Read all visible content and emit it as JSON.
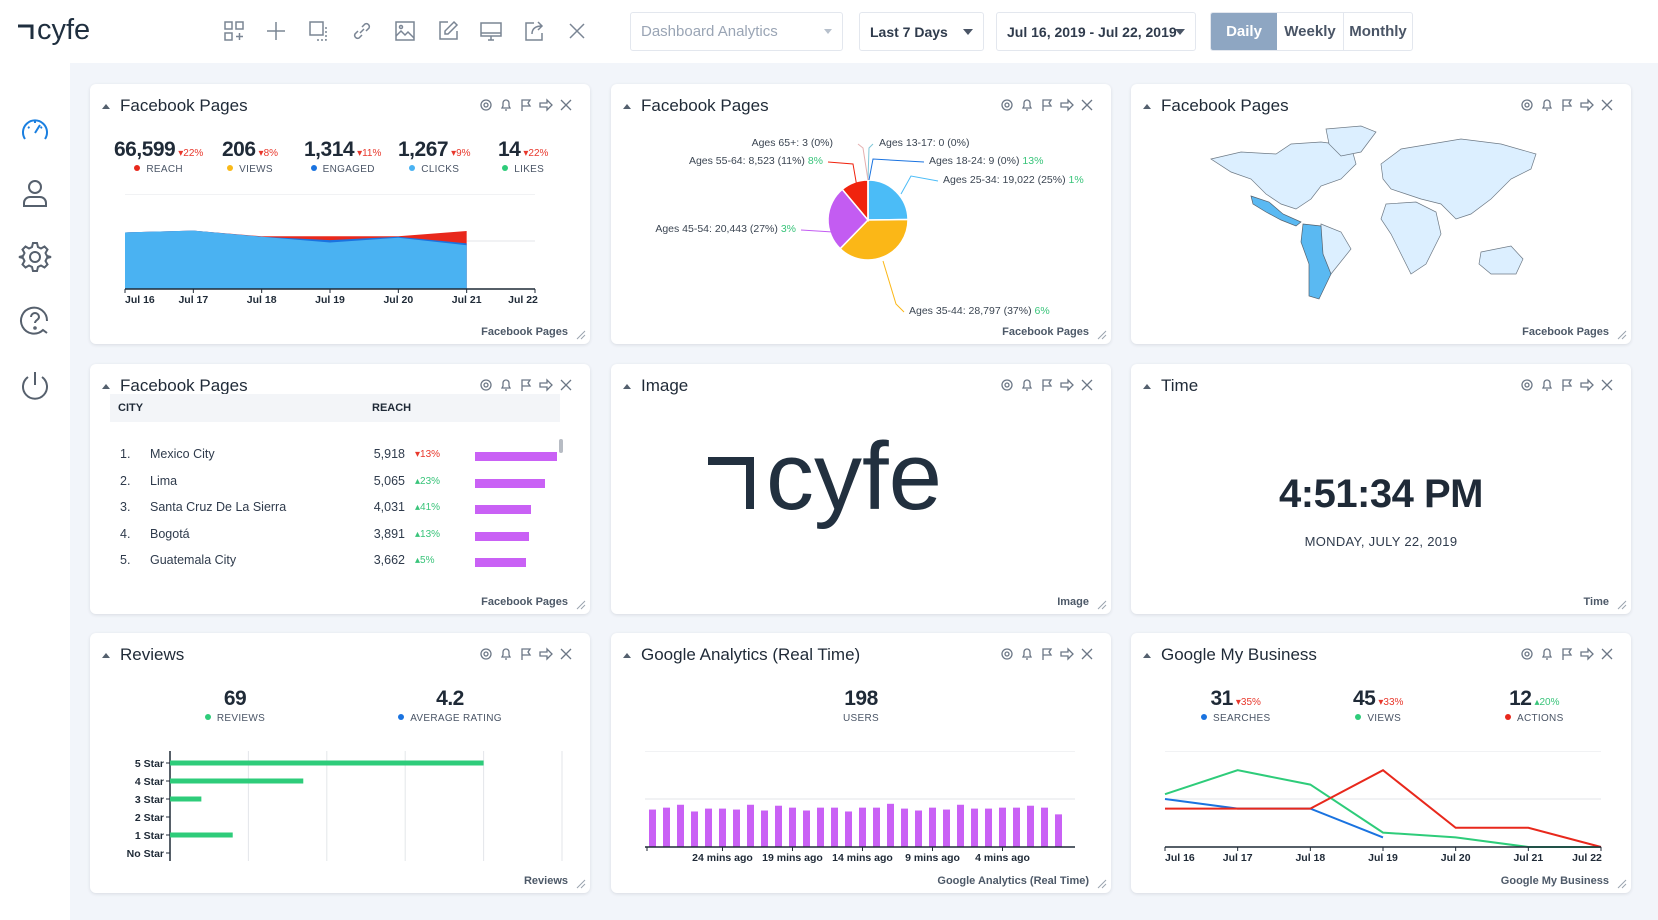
{
  "app": {
    "logo": "cyfe"
  },
  "toolbar": {
    "icons": [
      "add-widget-icon",
      "plus-icon",
      "duplicate-icon",
      "link-icon",
      "image-icon",
      "edit-icon",
      "monitor-icon",
      "share-icon",
      "close-icon"
    ],
    "dashboard_select": {
      "placeholder": "Dashboard Analytics"
    },
    "range_select": {
      "value": "Last 7 Days"
    },
    "date_select": {
      "value": "Jul 16, 2019 - Jul 22, 2019"
    },
    "periods": [
      {
        "label": "Daily",
        "active": true
      },
      {
        "label": "Weekly",
        "active": false
      },
      {
        "label": "Monthly",
        "active": false
      }
    ]
  },
  "sidebar": {
    "items": [
      {
        "icon": "dashboard-gauge-icon",
        "active": true,
        "color": "#1a7fe0"
      },
      {
        "icon": "user-icon",
        "active": false
      },
      {
        "icon": "gear-icon",
        "active": false
      },
      {
        "icon": "help-icon",
        "active": false
      },
      {
        "icon": "power-icon",
        "active": false
      }
    ]
  },
  "colors": {
    "reach": "#e8281c",
    "views": "#f9b918",
    "engaged": "#1a73e0",
    "clicks": "#4ab2f2",
    "likes": "#2ecc7a",
    "down": "#e8382c",
    "up": "#39c47a",
    "bar_purple": "#c961f5",
    "review_green": "#2ecc7a"
  },
  "widgets": {
    "fb_overview": {
      "title": "Facebook Pages",
      "footer": "Facebook Pages",
      "kpis": [
        {
          "value": "66,599",
          "change": "22%",
          "dir": "down",
          "label": "REACH"
        },
        {
          "value": "206",
          "change": "8%",
          "dir": "down",
          "label": "VIEWS"
        },
        {
          "value": "1,314",
          "change": "11%",
          "dir": "down",
          "label": "ENGAGED"
        },
        {
          "value": "1,267",
          "change": "9%",
          "dir": "down",
          "label": "CLICKS"
        },
        {
          "value": "14",
          "change": "22%",
          "dir": "down",
          "label": "LIKES"
        }
      ]
    },
    "fb_demographics": {
      "title": "Facebook Pages",
      "footer": "Facebook Pages"
    },
    "fb_map": {
      "title": "Facebook Pages",
      "footer": "Facebook Pages",
      "highlighted_regions": [
        "Mexico",
        "Central America",
        "Colombia",
        "Ecuador",
        "Peru",
        "Bolivia",
        "Chile",
        "Argentina",
        "Paraguay"
      ]
    },
    "fb_cities": {
      "title": "Facebook Pages",
      "footer": "Facebook Pages",
      "columns": [
        "CITY",
        "REACH"
      ],
      "rows": [
        {
          "rank": "1.",
          "city": "Mexico City",
          "reach": "5,918",
          "reach_value": 5918,
          "change": "13%",
          "dir": "down"
        },
        {
          "rank": "2.",
          "city": "Lima",
          "reach": "5,065",
          "reach_value": 5065,
          "change": "23%",
          "dir": "up"
        },
        {
          "rank": "3.",
          "city": "Santa Cruz De La Sierra",
          "reach": "4,031",
          "reach_value": 4031,
          "change": "41%",
          "dir": "up"
        },
        {
          "rank": "4.",
          "city": "Bogotá",
          "reach": "3,891",
          "reach_value": 3891,
          "change": "13%",
          "dir": "up"
        },
        {
          "rank": "5.",
          "city": "Guatemala City",
          "reach": "3,662",
          "reach_value": 3662,
          "change": "5%",
          "dir": "up"
        }
      ]
    },
    "image": {
      "title": "Image",
      "footer": "Image",
      "logo_text": "cyfe"
    },
    "time": {
      "title": "Time",
      "footer": "Time",
      "time": "4:51:34 PM",
      "date": "MONDAY, JULY 22, 2019"
    },
    "reviews": {
      "title": "Reviews",
      "footer": "Reviews",
      "kpis": [
        {
          "value": "69",
          "label": "REVIEWS",
          "color": "#2ecc7a"
        },
        {
          "value": "4.2",
          "label": "AVERAGE RATING",
          "color": "#1a73e0"
        }
      ]
    },
    "ga": {
      "title": "Google Analytics (Real Time)",
      "footer": "Google Analytics (Real Time)",
      "kpi": {
        "value": "198",
        "label": "USERS"
      }
    },
    "gmb": {
      "title": "Google My Business",
      "footer": "Google My Business",
      "kpis": [
        {
          "value": "31",
          "change": "35%",
          "dir": "down",
          "label": "SEARCHES",
          "color": "#1a73e0"
        },
        {
          "value": "45",
          "change": "33%",
          "dir": "down",
          "label": "VIEWS",
          "color": "#2ecc7a"
        },
        {
          "value": "12",
          "change": "20%",
          "dir": "up",
          "label": "ACTIONS",
          "color": "#e8281c"
        }
      ]
    }
  },
  "chart_data": [
    {
      "id": "fb_area",
      "type": "area",
      "categories": [
        "Jul 16",
        "Jul 17",
        "Jul 18",
        "Jul 19",
        "Jul 20",
        "Jul 21",
        "Jul 22"
      ],
      "ylim": [
        0,
        20000
      ],
      "grid": true,
      "series": [
        {
          "name": "Reach",
          "color": "#e8281c",
          "values": [
            11900,
            12300,
            11100,
            11100,
            11100,
            12200,
            null
          ]
        },
        {
          "name": "Engaged",
          "color": "#1a73e0",
          "values": [
            11900,
            12300,
            11000,
            10300,
            11000,
            9600,
            null
          ]
        },
        {
          "name": "Clicks",
          "color": "#4ab2f2",
          "values": [
            11900,
            12300,
            11000,
            9800,
            10800,
            9200,
            null
          ]
        },
        {
          "name": "Likes",
          "color": "#2ecc7a",
          "values": [
            100,
            100,
            100,
            100,
            100,
            100,
            null
          ]
        }
      ]
    },
    {
      "id": "fb_age_pie",
      "type": "pie",
      "slices": [
        {
          "label": "Ages 13-17",
          "value": 0,
          "pct": "0%",
          "change": "",
          "color": "#7fc6d8"
        },
        {
          "label": "Ages 18-24",
          "value": 9,
          "pct": "0%",
          "change": "13%",
          "color": "#1a73e0"
        },
        {
          "label": "Ages 25-34",
          "value": 19022,
          "pct": "25%",
          "change": "1%",
          "color": "#4bbcf7"
        },
        {
          "label": "Ages 35-44",
          "value": 28797,
          "pct": "37%",
          "change": "6%",
          "color": "#fbb717"
        },
        {
          "label": "Ages 45-54",
          "value": 20443,
          "pct": "27%",
          "change": "3%",
          "color": "#c35cf2"
        },
        {
          "label": "Ages 55-64",
          "value": 8523,
          "pct": "11%",
          "change": "8%",
          "color": "#f0230e"
        },
        {
          "label": "Ages 65+",
          "value": 3,
          "pct": "0%",
          "change": "",
          "color": "#e5b0b0"
        }
      ]
    },
    {
      "id": "reviews_bar",
      "type": "bar",
      "orientation": "horizontal",
      "categories": [
        "5 Star",
        "4 Star",
        "3 Star",
        "2 Star",
        "1 Star",
        "No Star"
      ],
      "values": [
        40,
        17,
        4,
        0,
        8,
        0
      ],
      "xlim": [
        0,
        50
      ],
      "grid": true
    },
    {
      "id": "ga_users_bar",
      "type": "bar",
      "xticks": [
        "24 mins ago",
        "19 mins ago",
        "14 mins ago",
        "9 mins ago",
        "4 mins ago"
      ],
      "values": [
        7.8,
        8.2,
        8.8,
        7.4,
        8.0,
        8.0,
        7.8,
        8.8,
        7.6,
        8.6,
        8.2,
        7.6,
        8.2,
        8.2,
        7.4,
        8.2,
        8.2,
        9.0,
        8.0,
        7.6,
        8.2,
        7.8,
        8.8,
        8.0,
        8.0,
        8.2,
        8.2,
        8.6,
        8.2,
        6.8
      ],
      "ylim": [
        0,
        20
      ],
      "grid": true
    },
    {
      "id": "gmb_lines",
      "type": "line",
      "categories": [
        "Jul 16",
        "Jul 17",
        "Jul 18",
        "Jul 19",
        "Jul 20",
        "Jul 21",
        "Jul 22"
      ],
      "ylim": [
        0,
        10
      ],
      "grid": true,
      "series": [
        {
          "name": "Searches",
          "color": "#1a73e0",
          "values": [
            5,
            4,
            4,
            1,
            null,
            null,
            null
          ]
        },
        {
          "name": "Views",
          "color": "#2ecc7a",
          "values": [
            5.5,
            8,
            6.5,
            1.5,
            1,
            0,
            0
          ]
        },
        {
          "name": "Actions",
          "color": "#e8281c",
          "values": [
            4,
            4,
            4,
            8,
            2,
            2,
            0
          ]
        }
      ]
    }
  ]
}
